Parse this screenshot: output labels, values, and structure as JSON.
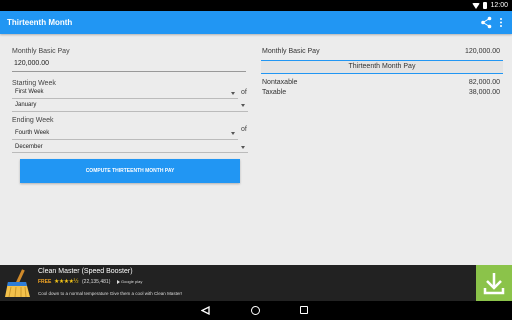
{
  "status_bar": {
    "time": "12:00"
  },
  "app_bar": {
    "title": "Thirteenth Month"
  },
  "form": {
    "monthly_basic_pay_label": "Monthly Basic Pay",
    "monthly_basic_pay_value": "120,000.00",
    "starting_week_label": "Starting Week",
    "starting_week_value": "First Week",
    "starting_month_value": "January",
    "ending_week_label": "Ending Week",
    "ending_week_value": "Fourth Week",
    "ending_month_value": "December",
    "of_label": "of",
    "compute_button": "COMPUTE THIRTEENTH MONTH PAY"
  },
  "result": {
    "monthly_basic_pay_label": "Monthly Basic Pay",
    "monthly_basic_pay_value": "120,000.00",
    "section_title": "Thirteenth Month Pay",
    "nontaxable_label": "Nontaxable",
    "nontaxable_value": "82,000.00",
    "taxable_label": "Taxable",
    "taxable_value": "38,000.00"
  },
  "ad": {
    "app_name": "Clean Master (Speed Booster)",
    "price": "FREE",
    "stars": "★★★★½",
    "reviews": "(22,135,481)",
    "store": "Google play",
    "description": "Cool down to a normal temperature Give them a cool with Clean Master!"
  },
  "colors": {
    "accent": "#2196f3",
    "ad_download": "#8bc34a"
  }
}
